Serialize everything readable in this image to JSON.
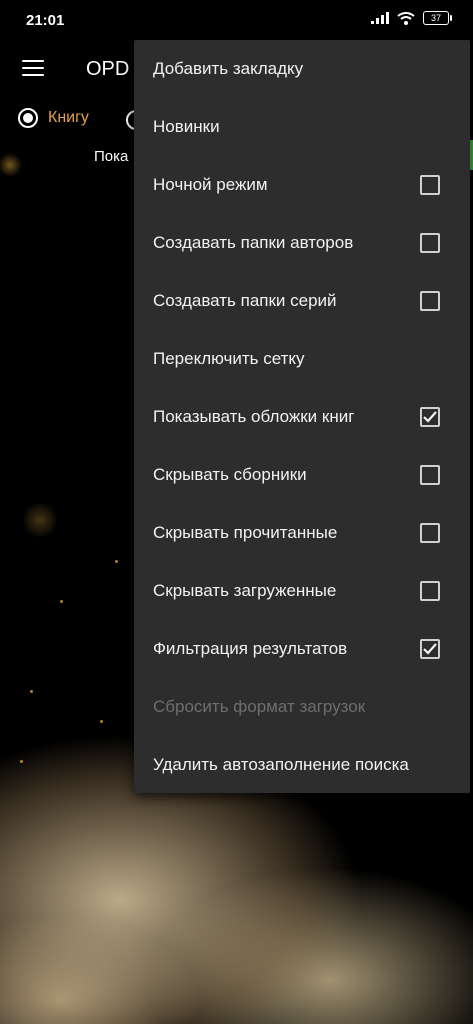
{
  "status_bar": {
    "time": "21:01",
    "battery": "37"
  },
  "toolbar": {
    "title": "OPD"
  },
  "search_type": {
    "selected_label": "Книгу"
  },
  "hint": "Пока",
  "menu": {
    "items": [
      {
        "label": "Добавить закладку",
        "type": "action"
      },
      {
        "label": "Новинки",
        "type": "action"
      },
      {
        "label": "Ночной режим",
        "type": "checkbox",
        "checked": false
      },
      {
        "label": "Создавать папки авторов",
        "type": "checkbox",
        "checked": false
      },
      {
        "label": "Создавать папки серий",
        "type": "checkbox",
        "checked": false
      },
      {
        "label": "Переключить сетку",
        "type": "action"
      },
      {
        "label": "Показывать обложки книг",
        "type": "checkbox",
        "checked": true
      },
      {
        "label": "Скрывать сборники",
        "type": "checkbox",
        "checked": false
      },
      {
        "label": "Скрывать прочитанные",
        "type": "checkbox",
        "checked": false
      },
      {
        "label": "Скрывать загруженные",
        "type": "checkbox",
        "checked": false
      },
      {
        "label": "Фильтрация результатов",
        "type": "checkbox",
        "checked": true
      },
      {
        "label": "Сбросить формат загрузок",
        "type": "action",
        "disabled": true
      },
      {
        "label": "Удалить автозаполнение поиска",
        "type": "action"
      }
    ]
  },
  "colors": {
    "accent_orange": "#e8a048",
    "menu_background": "#2d2d2d",
    "accent_green": "#3fae48"
  }
}
